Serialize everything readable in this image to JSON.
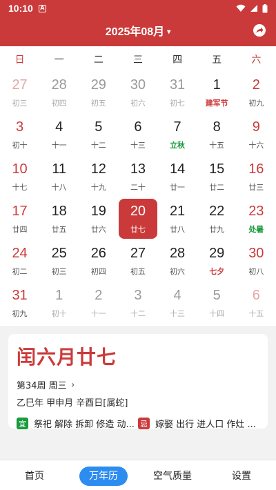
{
  "status": {
    "time": "10:10",
    "app_icon_letter": "A"
  },
  "header": {
    "title": "2025年08月",
    "caret": "▾",
    "accent": "#cb3a3a"
  },
  "weekdays": [
    "日",
    "一",
    "二",
    "三",
    "四",
    "五",
    "六"
  ],
  "weeks": [
    [
      {
        "num": "27",
        "lunar": "初三",
        "other": true
      },
      {
        "num": "28",
        "lunar": "初四",
        "other": true
      },
      {
        "num": "29",
        "lunar": "初五",
        "other": true
      },
      {
        "num": "30",
        "lunar": "初六",
        "other": true
      },
      {
        "num": "31",
        "lunar": "初七",
        "other": true
      },
      {
        "num": "1",
        "lunar": "建军节",
        "style": "festival-red"
      },
      {
        "num": "2",
        "lunar": "初九"
      }
    ],
    [
      {
        "num": "3",
        "lunar": "初十"
      },
      {
        "num": "4",
        "lunar": "十一"
      },
      {
        "num": "5",
        "lunar": "十二"
      },
      {
        "num": "6",
        "lunar": "十三"
      },
      {
        "num": "7",
        "lunar": "立秋",
        "style": "term-green"
      },
      {
        "num": "8",
        "lunar": "十五"
      },
      {
        "num": "9",
        "lunar": "十六"
      }
    ],
    [
      {
        "num": "10",
        "lunar": "十七"
      },
      {
        "num": "11",
        "lunar": "十八"
      },
      {
        "num": "12",
        "lunar": "十九"
      },
      {
        "num": "13",
        "lunar": "二十"
      },
      {
        "num": "14",
        "lunar": "廿一"
      },
      {
        "num": "15",
        "lunar": "廿二"
      },
      {
        "num": "16",
        "lunar": "廿三"
      }
    ],
    [
      {
        "num": "17",
        "lunar": "廿四"
      },
      {
        "num": "18",
        "lunar": "廿五"
      },
      {
        "num": "19",
        "lunar": "廿六"
      },
      {
        "num": "20",
        "lunar": "廿七",
        "selected": true
      },
      {
        "num": "21",
        "lunar": "廿八"
      },
      {
        "num": "22",
        "lunar": "廿九"
      },
      {
        "num": "23",
        "lunar": "处暑",
        "style": "term-green"
      }
    ],
    [
      {
        "num": "24",
        "lunar": "初二"
      },
      {
        "num": "25",
        "lunar": "初三"
      },
      {
        "num": "26",
        "lunar": "初四"
      },
      {
        "num": "27",
        "lunar": "初五"
      },
      {
        "num": "28",
        "lunar": "初六"
      },
      {
        "num": "29",
        "lunar": "七夕",
        "style": "festival-red"
      },
      {
        "num": "30",
        "lunar": "初八"
      }
    ],
    [
      {
        "num": "31",
        "lunar": "初九"
      },
      {
        "num": "1",
        "lunar": "初十",
        "other": true
      },
      {
        "num": "2",
        "lunar": "十一",
        "other": true
      },
      {
        "num": "3",
        "lunar": "十二",
        "other": true
      },
      {
        "num": "4",
        "lunar": "十三",
        "other": true
      },
      {
        "num": "5",
        "lunar": "十四",
        "other": true
      },
      {
        "num": "6",
        "lunar": "十五",
        "other": true
      }
    ]
  ],
  "detail": {
    "lunar_date": "闰六月廿七",
    "week_info": "第34周 周三",
    "chevron": "›",
    "ganzhi": "乙巳年 甲申月 辛酉日[属蛇]",
    "yi_label": "宜",
    "yi_text": "祭祀 解除 拆卸 修造 动...",
    "ji_label": "忌",
    "ji_text": "嫁娶 出行 进人口 作灶 ..."
  },
  "nav": [
    {
      "label": "首页"
    },
    {
      "label": "万年历",
      "active": true
    },
    {
      "label": "空气质量"
    },
    {
      "label": "设置"
    }
  ]
}
